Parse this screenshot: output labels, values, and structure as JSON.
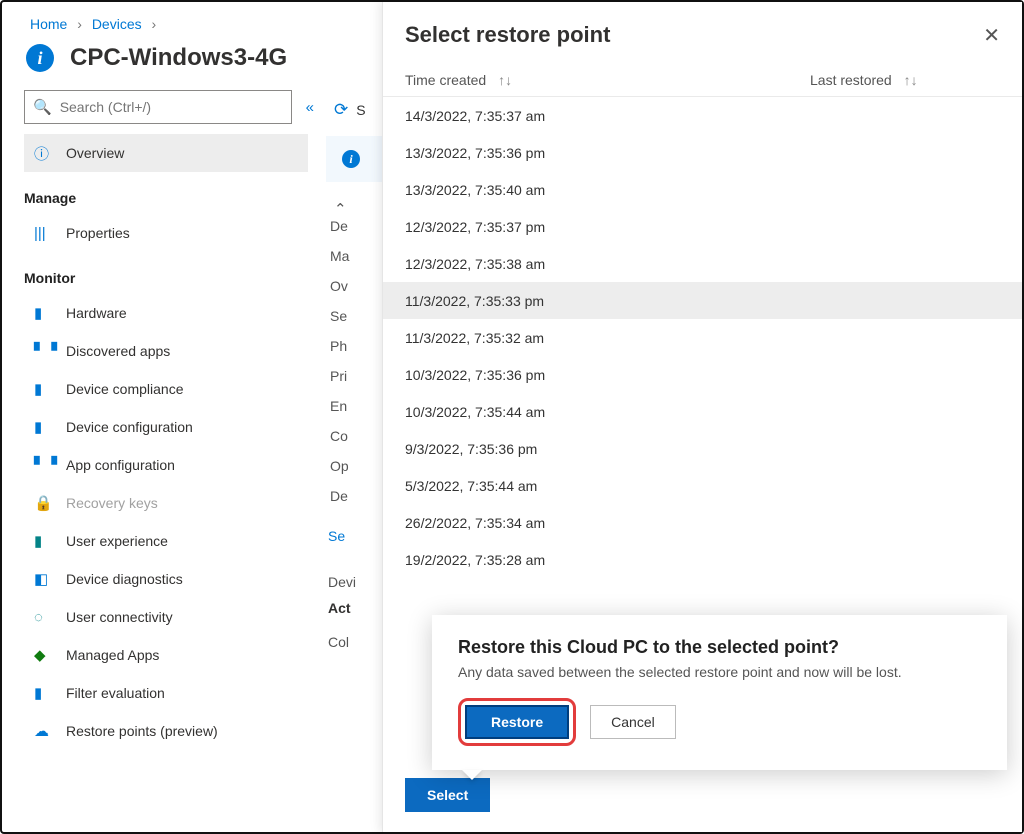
{
  "breadcrumb": {
    "home": "Home",
    "devices": "Devices"
  },
  "page_title": "CPC-Windows3-4G",
  "search": {
    "placeholder": "Search (Ctrl+/)"
  },
  "sidebar": {
    "overview": "Overview",
    "sections": {
      "manage": "Manage",
      "monitor": "Monitor"
    },
    "manage_items": [
      {
        "icon": "properties-icon",
        "glyph": "|||",
        "label": "Properties",
        "cls": "c-blue"
      }
    ],
    "monitor_items": [
      {
        "icon": "hardware-icon",
        "glyph": "▮",
        "label": "Hardware",
        "cls": "c-blue"
      },
      {
        "icon": "discovered-apps-icon",
        "glyph": "▘▝",
        "label": "Discovered apps",
        "cls": "c-blue"
      },
      {
        "icon": "device-compliance-icon",
        "glyph": "▮",
        "label": "Device compliance",
        "cls": "c-blue"
      },
      {
        "icon": "device-configuration-icon",
        "glyph": "▮",
        "label": "Device configuration",
        "cls": "c-blue"
      },
      {
        "icon": "app-configuration-icon",
        "glyph": "▘▝",
        "label": "App configuration",
        "cls": "c-blue"
      },
      {
        "icon": "recovery-keys-icon",
        "glyph": "🔒",
        "label": "Recovery keys",
        "disabled": true
      },
      {
        "icon": "user-experience-icon",
        "glyph": "▮",
        "label": "User experience",
        "cls": "c-teal"
      },
      {
        "icon": "device-diagnostics-icon",
        "glyph": "◧",
        "label": "Device diagnostics",
        "cls": "c-blue"
      },
      {
        "icon": "user-connectivity-icon",
        "glyph": "◌",
        "label": "User connectivity",
        "cls": "c-teal"
      },
      {
        "icon": "managed-apps-icon",
        "glyph": "◆",
        "label": "Managed Apps",
        "cls": "c-green"
      },
      {
        "icon": "filter-evaluation-icon",
        "glyph": "▮",
        "label": "Filter evaluation",
        "cls": "c-blue"
      },
      {
        "icon": "restore-points-icon",
        "glyph": "☁",
        "label": "Restore points (preview)",
        "cls": "c-blue"
      }
    ]
  },
  "main": {
    "sync_initial": "S",
    "stub_rows": [
      "De",
      "Ma",
      "Ov",
      "Se",
      "Ph",
      "Pri",
      "En",
      "Co",
      "Op",
      "De"
    ],
    "see_more": "Se",
    "devi": "Devi",
    "act": "Act",
    "col": "Col"
  },
  "panel": {
    "title": "Select restore point",
    "col_time": "Time created",
    "col_last": "Last restored",
    "rows": [
      "14/3/2022, 7:35:37 am",
      "13/3/2022, 7:35:36 pm",
      "13/3/2022, 7:35:40 am",
      "12/3/2022, 7:35:37 pm",
      "12/3/2022, 7:35:38 am",
      "11/3/2022, 7:35:33 pm",
      "11/3/2022, 7:35:32 am",
      "10/3/2022, 7:35:36 pm",
      "10/3/2022, 7:35:44 am",
      "9/3/2022, 7:35:36 pm",
      "5/3/2022, 7:35:44 am",
      "26/2/2022, 7:35:34 am",
      "19/2/2022, 7:35:28 am"
    ],
    "selected_index": 5,
    "select_btn": "Select"
  },
  "popup": {
    "title": "Restore this Cloud PC to the selected point?",
    "message": "Any data saved between the selected restore point and now will be lost.",
    "restore": "Restore",
    "cancel": "Cancel"
  }
}
